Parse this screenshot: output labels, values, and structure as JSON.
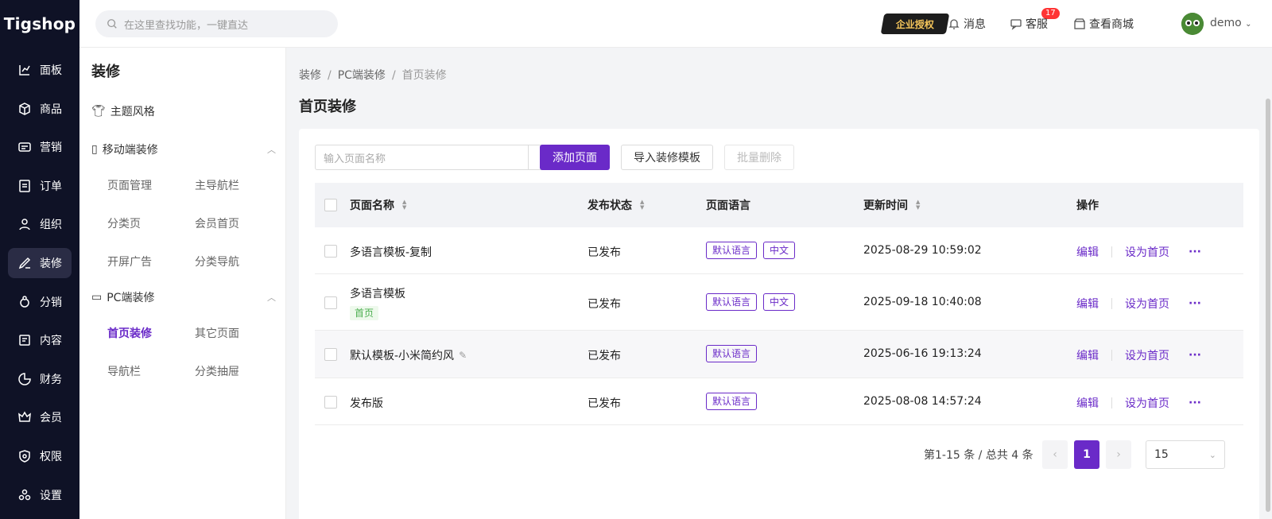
{
  "brand": {
    "logo": "Tigshop"
  },
  "search": {
    "placeholder": "在这里查找功能，一键直达"
  },
  "header": {
    "auth_badge": "企业授权",
    "messages_label": "消息",
    "messages_count": "17",
    "service_label": "客服",
    "store_label": "查看商城",
    "user_name": "demo"
  },
  "leftnav": {
    "items": [
      {
        "label": "面板",
        "icon": "chart-icon"
      },
      {
        "label": "商品",
        "icon": "box-icon"
      },
      {
        "label": "营销",
        "icon": "ticket-icon"
      },
      {
        "label": "订单",
        "icon": "doc-icon"
      },
      {
        "label": "组织",
        "icon": "people-icon"
      },
      {
        "label": "装修",
        "icon": "brush-icon"
      },
      {
        "label": "分销",
        "icon": "share-icon"
      },
      {
        "label": "内容",
        "icon": "content-icon"
      },
      {
        "label": "财务",
        "icon": "pie-icon"
      },
      {
        "label": "会员",
        "icon": "crown-icon"
      },
      {
        "label": "权限",
        "icon": "shield-icon"
      },
      {
        "label": "设置",
        "icon": "settings-icon"
      }
    ],
    "active_index": 5
  },
  "subnav": {
    "title": "装修",
    "theme_label": "主题风格",
    "mobile_group": "移动端装修",
    "mobile_items": [
      "页面管理",
      "主导航栏",
      "分类页",
      "会员首页",
      "开屏广告",
      "分类导航"
    ],
    "pc_group": "PC端装修",
    "pc_items": [
      "首页装修",
      "其它页面",
      "导航栏",
      "分类抽屉"
    ]
  },
  "breadcrumb": [
    "装修",
    "PC端装修",
    "首页装修"
  ],
  "page_title": "首页装修",
  "toolbar": {
    "search_placeholder": "输入页面名称",
    "add_label": "添加页面",
    "import_label": "导入装修模板",
    "delete_label": "批量删除"
  },
  "table": {
    "headers": [
      "页面名称",
      "发布状态",
      "页面语言",
      "更新时间",
      "操作"
    ],
    "rows": [
      {
        "name": "多语言模板-复制",
        "status": "已发布",
        "langs": [
          "默认语言",
          "中文"
        ],
        "updated": "2025-08-29 10:59:02",
        "home": ""
      },
      {
        "name": "多语言模板",
        "status": "已发布",
        "langs": [
          "默认语言",
          "中文"
        ],
        "updated": "2025-09-18 10:40:08",
        "home": "首页"
      },
      {
        "name": "默认模板-小米简约风",
        "status": "已发布",
        "langs": [
          "默认语言"
        ],
        "updated": "2025-06-16 19:13:24",
        "home": ""
      },
      {
        "name": "发布版",
        "status": "已发布",
        "langs": [
          "默认语言"
        ],
        "updated": "2025-08-08 14:57:24",
        "home": ""
      }
    ],
    "actions": {
      "edit": "编辑",
      "set_home": "设为首页",
      "more": "···"
    }
  },
  "pagination": {
    "info": "第1-15 条 / 总共 4 条",
    "current": "1",
    "page_size": "15",
    "prev": "‹",
    "next": "›"
  },
  "colors": {
    "primary": "#6a2ac8",
    "sidebar_bg": "#0f1226"
  }
}
